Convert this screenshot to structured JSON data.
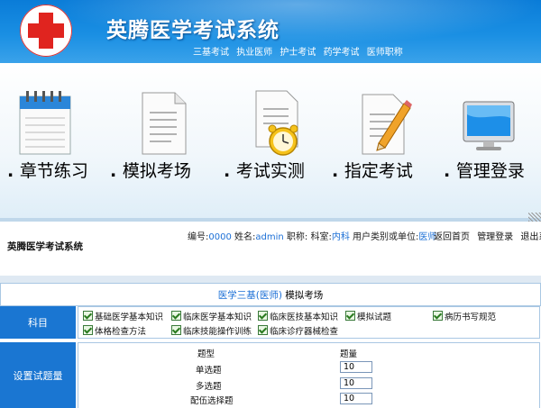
{
  "header": {
    "title": "英腾医学考试系统",
    "nav": [
      "三基考试",
      "执业医师",
      "护士考试",
      "药学考试",
      "医师职称"
    ]
  },
  "tiles": [
    {
      "label": "章节练习",
      "icon": "calendar-notepad-icon"
    },
    {
      "label": "模拟考场",
      "icon": "document-icon"
    },
    {
      "label": "考试实测",
      "icon": "alarm-clock-document-icon"
    },
    {
      "label": "指定考试",
      "icon": "pencil-document-icon"
    },
    {
      "label": "管理登录",
      "icon": "monitor-icon"
    }
  ],
  "infobar": {
    "system_name": "英腾医学考试系统",
    "id_label": "编号:",
    "id_value": "0000",
    "name_label": "姓名:",
    "name_value": "admin",
    "title_label": "职称:",
    "dept_label": "科室:",
    "dept_value": "内科",
    "unit_label": "用户类别或单位:",
    "unit_value": "医师",
    "links": [
      "返回首页",
      "管理登录",
      "退出系统"
    ]
  },
  "form": {
    "title_highlight": "医学三基(医师)",
    "title_rest": " 模拟考场",
    "subject_label": "科目",
    "subjects": [
      {
        "label": "基础医学基本知识",
        "checked": true
      },
      {
        "label": "临床医学基本知识",
        "checked": true
      },
      {
        "label": "临床医技基本知识",
        "checked": true
      },
      {
        "label": "模拟试题",
        "checked": true
      },
      {
        "label": "病历书写规范",
        "checked": true
      },
      {
        "label": "体格检查方法",
        "checked": true
      },
      {
        "label": "临床技能操作训练",
        "checked": true
      },
      {
        "label": "临床诊疗器械检查",
        "checked": true
      }
    ],
    "quantity_label": "设置试题量",
    "col_type": "题型",
    "col_count": "题量",
    "rows": [
      {
        "type": "单选题",
        "count": "10"
      },
      {
        "type": "多选题",
        "count": "10"
      },
      {
        "type": "配伍选择题",
        "count": "10"
      }
    ]
  },
  "colors": {
    "header_blue": "#1a8fe3",
    "label_blue": "#1a76d2",
    "link_blue": "#1b6fd6",
    "logo_red": "#e0241f"
  }
}
